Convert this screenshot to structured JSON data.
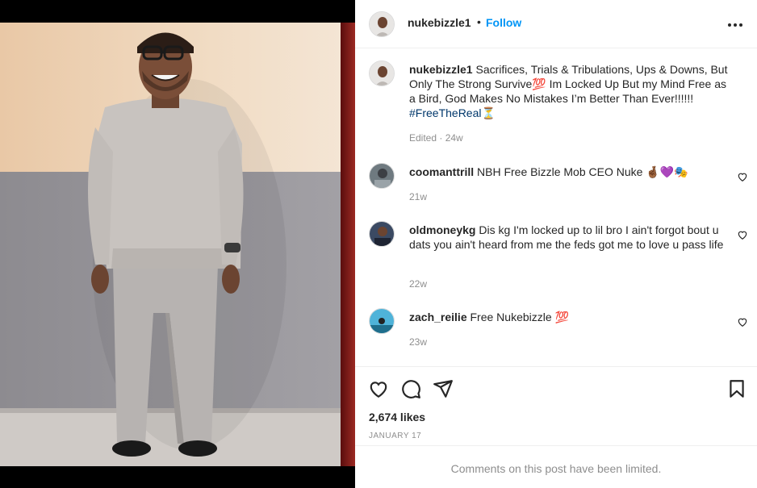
{
  "post": {
    "username": "nukebizzle1",
    "dot": "•",
    "follow_label": "Follow",
    "more_icon": "more-horizontal-icon"
  },
  "caption": {
    "username": "nukebizzle1",
    "text": "Sacrifices, Trials & Tribulations, Ups & Downs, But Only The Strong Survive💯 Im Locked Up But my Mind Free as a Bird, God Makes No Mistakes I’m Better Than Ever!!!!!! ",
    "hashtag": "#FreeTheReal",
    "emoji_end": "⏳",
    "meta": "Edited · 24w"
  },
  "comments": [
    {
      "username": "coomanttrill",
      "text": "NBH Free Bizzle Mob CEO Nuke 🤞🏾💜🎭",
      "time": "21w"
    },
    {
      "username": "oldmoneykg",
      "text": "Dis kg I'm locked up to lil bro I ain't forgot bout u dats you ain't heard from me the feds got me to love u pass life",
      "time": "22w"
    },
    {
      "username": "zach_reilie",
      "text": "Free Nukebizzle 💯",
      "time": "23w"
    }
  ],
  "actions": {
    "like_icon": "heart-icon",
    "comment_icon": "comment-icon",
    "share_icon": "paper-plane-icon",
    "save_icon": "bookmark-icon"
  },
  "likes": "2,674 likes",
  "date": "JANUARY 17",
  "comments_limited": "Comments on this post have been limited.",
  "colors": {
    "link_blue": "#0095f6",
    "hashtag": "#00376b",
    "muted": "#8e8e8e",
    "text": "#262626"
  }
}
